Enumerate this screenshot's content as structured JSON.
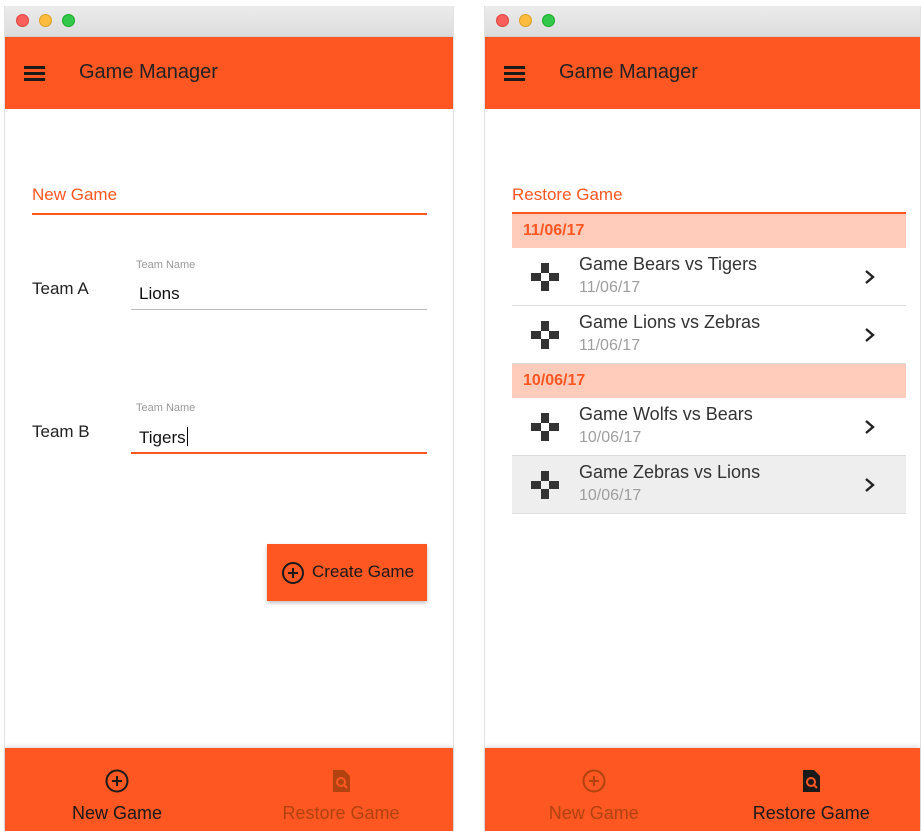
{
  "app_title": "Game Manager",
  "colors": {
    "accent": "#ff5722",
    "date_header_bg": "#ffccbc",
    "selected_row_bg": "#eeeeee"
  },
  "new_game_screen": {
    "section_title": "New Game",
    "team_a": {
      "label": "Team A",
      "hint": "Team Name",
      "value": "Lions"
    },
    "team_b": {
      "label": "Team B",
      "hint": "Team Name",
      "value": "Tigers"
    },
    "create_button": {
      "label": "Create Game",
      "icon": "add-circle-icon"
    }
  },
  "restore_game_screen": {
    "section_title": "Restore Game",
    "groups": [
      {
        "date": "11/06/17",
        "games": [
          {
            "title": "Game Bears vs Tigers",
            "date": "11/06/17",
            "icon": "gamepad-icon"
          },
          {
            "title": "Game Lions vs Zebras",
            "date": "11/06/17",
            "icon": "gamepad-icon"
          }
        ]
      },
      {
        "date": "10/06/17",
        "games": [
          {
            "title": "Game Wolfs vs Bears",
            "date": "10/06/17",
            "icon": "gamepad-icon"
          },
          {
            "title": "Game Zebras vs Lions",
            "date": "10/06/17",
            "icon": "gamepad-icon",
            "selected": true
          }
        ]
      }
    ]
  },
  "bottom_nav": {
    "new_game_label": "New Game",
    "restore_game_label": "Restore Game"
  }
}
